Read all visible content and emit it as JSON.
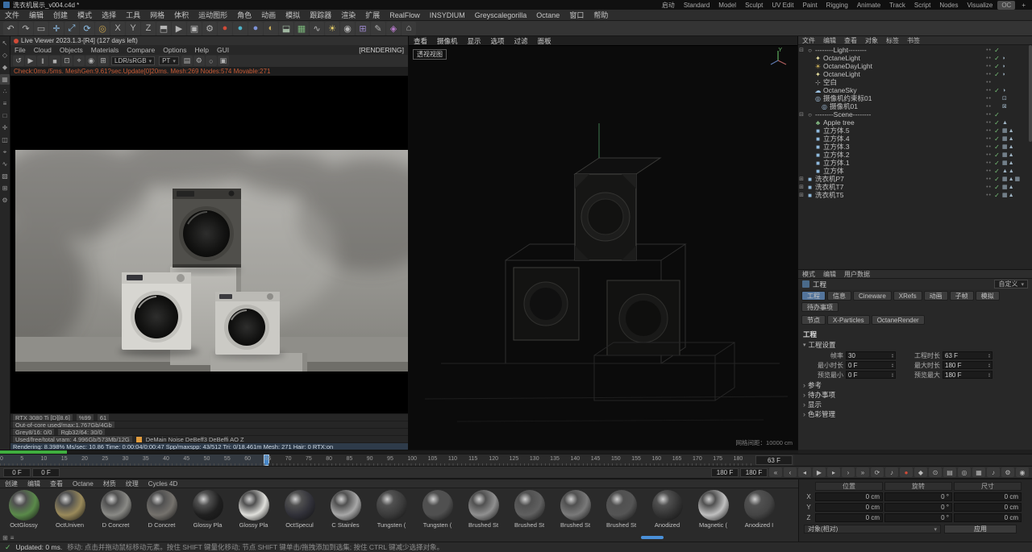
{
  "titlebar": {
    "title": "洗衣机展示_v004.c4d *",
    "layouts": [
      {
        "label": "启动"
      },
      {
        "label": "Standard"
      },
      {
        "label": "Model"
      },
      {
        "label": "Sculpt"
      },
      {
        "label": "UV Edit"
      },
      {
        "label": "Paint"
      },
      {
        "label": "Rigging"
      },
      {
        "label": "Animate"
      },
      {
        "label": "Track"
      },
      {
        "label": "Script"
      },
      {
        "label": "Nodes"
      },
      {
        "label": "Visualize"
      },
      {
        "label": "OC",
        "bg": "#4a4a4a"
      }
    ],
    "plus": "+"
  },
  "menubar": {
    "items": [
      "文件",
      "编辑",
      "创建",
      "模式",
      "选择",
      "工具",
      "网格",
      "体积",
      "运动图形",
      "角色",
      "动画",
      "模拟",
      "跟踪器",
      "渲染",
      "扩展",
      "RealFlow",
      "INSYDIUM",
      "Greyscalegorilla",
      "Octane",
      "窗口",
      "帮助"
    ]
  },
  "toolbar": {
    "items": [
      {
        "g": "↶",
        "n": "undo-icon"
      },
      {
        "g": "↷",
        "n": "redo-icon"
      },
      {
        "g": "▭",
        "n": "rectangle-select-icon"
      },
      {
        "g": "✛",
        "n": "move-tool-icon",
        "c": "#8fc1ea"
      },
      {
        "g": "⤢",
        "n": "scale-tool-icon",
        "c": "#8fc1ea"
      },
      {
        "g": "⟳",
        "n": "rotate-tool-icon",
        "c": "#8fc1ea"
      },
      {
        "g": "◎",
        "n": "last-tool-icon",
        "c": "#c8a24a"
      },
      {
        "g": "X",
        "n": "x-axis-lock-icon"
      },
      {
        "g": "Y",
        "n": "y-axis-lock-icon"
      },
      {
        "g": "Z",
        "n": "z-axis-lock-icon"
      },
      {
        "g": "⬒",
        "n": "coordinate-system-icon"
      },
      {
        "g": "▶",
        "n": "render-view-icon"
      },
      {
        "g": "▣",
        "n": "picture-viewer-icon"
      },
      {
        "g": "⚙",
        "n": "render-settings-icon"
      },
      {
        "g": "●",
        "n": "octane-live-viewer-icon",
        "c": "#d14b38"
      },
      {
        "g": "●",
        "n": "octane-material-icon",
        "c": "#4fb3c9"
      },
      {
        "g": "●",
        "n": "standard-material-icon",
        "c": "#7d92d8"
      },
      {
        "g": "◐",
        "n": "environment-icon",
        "c": "#cdb05d"
      },
      {
        "g": "⬓",
        "n": "floor-icon",
        "c": "#9fb6a0"
      },
      {
        "g": "▦",
        "n": "cube-primitive-icon",
        "c": "#79b579"
      },
      {
        "g": "∿",
        "n": "spline-icon"
      },
      {
        "g": "☀",
        "n": "light-icon",
        "c": "#e6cf6b"
      },
      {
        "g": "◉",
        "n": "camera-icon"
      },
      {
        "g": "⊞",
        "n": "mograph-icon",
        "c": "#9a86c9"
      },
      {
        "g": "✎",
        "n": "sculpt-icon"
      },
      {
        "g": "◈",
        "n": "deformer-icon",
        "c": "#b579c9"
      },
      {
        "g": "⌂",
        "n": "scene-nodes-icon"
      }
    ]
  },
  "leftstrip": {
    "items": [
      {
        "g": "↖",
        "n": "live-selection-icon"
      },
      {
        "g": "◇",
        "n": "make-editable-icon"
      },
      {
        "g": "◆",
        "n": "model-mode-icon"
      },
      {
        "g": "▦",
        "n": "texture-mode-icon",
        "bg": "#3f3f3f"
      },
      {
        "g": "∴",
        "n": "points-mode-icon"
      },
      {
        "g": "≡",
        "n": "edges-mode-icon"
      },
      {
        "g": "□",
        "n": "polygon-mode-icon"
      },
      {
        "g": "✛",
        "n": "axis-mode-icon"
      },
      {
        "g": "◫",
        "n": "workplane-icon"
      },
      {
        "g": "⌖",
        "n": "snap-icon"
      },
      {
        "g": "∿",
        "n": "spline-pen-icon"
      },
      {
        "g": "▧",
        "n": "uv-edit-icon"
      },
      {
        "g": "⊞",
        "n": "viewport-layout-icon"
      },
      {
        "g": "⚙",
        "n": "modes-settings-icon"
      }
    ]
  },
  "live_viewer": {
    "title": "Live Viewer 2023.1.3-[R4] (127 days left)",
    "menu": [
      "File",
      "Cloud",
      "Objects",
      "Materials",
      "Compare",
      "Options",
      "Help",
      "GUI"
    ],
    "rendering_badge": "[RENDERING]",
    "tools_left": [
      {
        "g": "↺",
        "n": "restart-render-icon"
      },
      {
        "g": "▶",
        "n": "resume-render-icon"
      },
      {
        "g": "‖",
        "n": "pause-render-icon"
      },
      {
        "g": "■",
        "n": "stop-render-icon"
      },
      {
        "g": "⊡",
        "n": "region-render-icon"
      },
      {
        "g": "⌖",
        "n": "focus-picker-icon"
      },
      {
        "g": "◉",
        "n": "material-picker-icon"
      },
      {
        "g": "⊞",
        "n": "lock-resolution-icon"
      }
    ],
    "lut": "LDR/sRGB",
    "kernel": "PT",
    "tools_right": [
      {
        "g": "▤",
        "n": "render-passes-icon"
      },
      {
        "g": "⚙",
        "n": "kernel-settings-icon"
      },
      {
        "g": "○",
        "n": "denoiser-icon"
      },
      {
        "g": "▣",
        "n": "camera-imager-icon"
      }
    ],
    "info_line": "Check:0ms./5ms. MeshGen:9.61?sec.Update[0]20ms. Mesh:269 Nodes:574 Movable:271",
    "stats": {
      "gpu": "RTX 3080 Ti [D][8.6]",
      "gpu_pct": "%99",
      "gpu_temp": "61",
      "outofcore": "Out-of-core used/max:1.767Gb/4Gb",
      "grey": "Grey8/16: 0/0",
      "rgb": "Rgb32/64: 30/0",
      "vram": "Used/free/total vram: 4.996Gb/573Mb/12G",
      "passes": "DeMain  Noise  DeBeff3  DeBeffi  AO  Z",
      "line5": "Rendering: 8.398%  Ms/sec: 10.86   Time: 0:00:04/0:00:47   Spp/maxspp: 43/512   Tri: 0/18.461m   Mesh: 271  Hair: 0  RTX:on"
    },
    "progress_width": "8.4%"
  },
  "viewport": {
    "menu": [
      "查看",
      "摄像机",
      "显示",
      "选项",
      "过滤",
      "面板"
    ],
    "label": "透视视图",
    "grid_info": "网格间距：10000 cm",
    "axis_y": "Y"
  },
  "object_manager": {
    "menu": [
      "文件",
      "编辑",
      "查看",
      "对象",
      "标签",
      "书签"
    ],
    "items": [
      {
        "arrow": "⊟",
        "icon": "○",
        "ic": "#b0b0b0",
        "label": "--------Light--------",
        "dots": "••",
        "check": "✓",
        "tags": "",
        "pad": "0px"
      },
      {
        "arrow": "",
        "icon": "✦",
        "ic": "#e8e0a0",
        "label": "OctaneLight",
        "dots": "••",
        "check": "✓",
        "tags": "◗",
        "pad": "10px"
      },
      {
        "arrow": "",
        "icon": "☀",
        "ic": "#e2c25f",
        "label": "OctaneDayLight",
        "dots": "••",
        "check": "✓",
        "tags": "◗",
        "pad": "10px"
      },
      {
        "arrow": "",
        "icon": "✦",
        "ic": "#e8e0a0",
        "label": "OctaneLight",
        "dots": "••",
        "check": "✓",
        "tags": "◗",
        "pad": "10px"
      },
      {
        "arrow": "",
        "icon": "⊹",
        "ic": "#b0b0b0",
        "label": "空白",
        "dots": "••",
        "check": "",
        "tags": "",
        "pad": "10px"
      },
      {
        "arrow": "",
        "icon": "☁",
        "ic": "#9ec3e4",
        "label": "OctaneSky",
        "dots": "••",
        "check": "✓",
        "tags": "◑",
        "pad": "10px"
      },
      {
        "arrow": "",
        "icon": "◎",
        "ic": "#a9c6e2",
        "label": "摄像机约束标01",
        "dots": "••",
        "check": "",
        "tags": "⊡",
        "pad": "10px"
      },
      {
        "arrow": "",
        "icon": "◎",
        "ic": "#a9c6e2",
        "label": "摄像机01",
        "dots": "••",
        "check": "",
        "tags": "⊠",
        "pad": "18px"
      },
      {
        "arrow": "⊟",
        "icon": "○",
        "ic": "#b0b0b0",
        "label": "--------Scene--------",
        "dots": "••",
        "check": "✓",
        "tags": "",
        "pad": "0px"
      },
      {
        "arrow": "",
        "icon": "♣",
        "ic": "#84bb84",
        "label": "Apple tree",
        "dots": "••",
        "check": "✓",
        "tags": "▲",
        "pad": "10px"
      },
      {
        "arrow": "",
        "icon": "■",
        "ic": "#8fb9dd",
        "label": "立方体.5",
        "dots": "••",
        "check": "✓",
        "tags": "▦▲",
        "pad": "10px"
      },
      {
        "arrow": "",
        "icon": "■",
        "ic": "#8fb9dd",
        "label": "立方体.4",
        "dots": "••",
        "check": "✓",
        "tags": "▦▲",
        "pad": "10px"
      },
      {
        "arrow": "",
        "icon": "■",
        "ic": "#8fb9dd",
        "label": "立方体.3",
        "dots": "••",
        "check": "✓",
        "tags": "▦▲",
        "pad": "10px"
      },
      {
        "arrow": "",
        "icon": "■",
        "ic": "#8fb9dd",
        "label": "立方体.2",
        "dots": "••",
        "check": "✓",
        "tags": "▦▲",
        "pad": "10px"
      },
      {
        "arrow": "",
        "icon": "■",
        "ic": "#8fb9dd",
        "label": "立方体.1",
        "dots": "••",
        "check": "✓",
        "tags": "▦▲",
        "pad": "10px"
      },
      {
        "arrow": "",
        "icon": "■",
        "ic": "#8fb9dd",
        "label": "立方体",
        "dots": "••",
        "check": "✓",
        "tags": "▲▲",
        "pad": "10px"
      },
      {
        "arrow": "⊞",
        "icon": "■",
        "ic": "#8fb9dd",
        "label": "洗衣机P7",
        "dots": "••",
        "check": "✓",
        "tags": "▦▲▦",
        "pad": "0px"
      },
      {
        "arrow": "⊞",
        "icon": "■",
        "ic": "#8fb9dd",
        "label": "洗衣机T7",
        "dots": "••",
        "check": "✓",
        "tags": "▦▲",
        "pad": "0px"
      },
      {
        "arrow": "⊞",
        "icon": "■",
        "ic": "#8fb9dd",
        "label": "洗衣机T5",
        "dots": "••",
        "check": "✓",
        "tags": "▦▲",
        "pad": "0px"
      }
    ]
  },
  "attributes": {
    "menu": [
      "模式",
      "编辑",
      "用户数据"
    ],
    "preset": "自定义",
    "object_label": "工程",
    "tabs": [
      {
        "label": "工程",
        "bg": "#53749b"
      },
      {
        "label": "信息"
      },
      {
        "label": "Cineware"
      },
      {
        "label": "XRefs"
      },
      {
        "label": "动画"
      },
      {
        "label": "子帧"
      },
      {
        "label": "模拟"
      },
      {
        "label": "待办事项"
      }
    ],
    "tabs2": [
      {
        "label": "节点"
      },
      {
        "label": "X-Particles"
      },
      {
        "label": "OctaneRender"
      }
    ],
    "group_title": "工程",
    "section": "工程设置",
    "fields": [
      {
        "l1": "帧率",
        "v1": "30",
        "l2": "工程时长",
        "v2": "63 F"
      },
      {
        "l1": "最小时长",
        "v1": "0 F",
        "l2": "最大时长",
        "v2": "180 F"
      },
      {
        "l1": "预览最小",
        "v1": "0 F",
        "l2": "预览最大",
        "v2": "180 F"
      }
    ],
    "collapsed": [
      "参考",
      "待办事项",
      "显示",
      "色彩管理"
    ]
  },
  "timeline": {
    "ticks": [
      "0",
      "5",
      "10",
      "15",
      "20",
      "25",
      "30",
      "35",
      "40",
      "45",
      "50",
      "55",
      "60",
      "65",
      "70",
      "75",
      "80",
      "85",
      "90",
      "95",
      "100",
      "105",
      "110",
      "115",
      "120",
      "125",
      "130",
      "135",
      "140",
      "145",
      "150",
      "155",
      "160",
      "165",
      "170",
      "175",
      "180"
    ],
    "current": "63 F",
    "shade_width": "35%",
    "playhead_left": "35%"
  },
  "transport": {
    "f1": "0 F",
    "f2": "0 F",
    "f3": "180 F",
    "f4": "180 F",
    "buttons": [
      {
        "g": "«",
        "n": "go-to-start-button"
      },
      {
        "g": "‹",
        "n": "previous-key-button"
      },
      {
        "g": "◂",
        "n": "previous-frame-button"
      },
      {
        "g": "▶",
        "n": "play-button"
      },
      {
        "g": "▸",
        "n": "next-frame-button"
      },
      {
        "g": "›",
        "n": "next-key-button"
      },
      {
        "g": "»",
        "n": "go-to-end-button"
      },
      {
        "g": "⟳",
        "n": "loop-mode-button"
      },
      {
        "g": "♪",
        "n": "sound-button"
      },
      {
        "g": "●",
        "n": "record-button",
        "c": "#d14b38"
      },
      {
        "g": "◆",
        "n": "keyframe-button"
      },
      {
        "g": "⊙",
        "n": "autokey-button"
      },
      {
        "g": "▤",
        "n": "key-filter-button"
      },
      {
        "g": "◎",
        "n": "key-options-button"
      }
    ],
    "right": [
      {
        "g": "▦",
        "n": "timeline-panel-icon"
      },
      {
        "g": "♪",
        "n": "sound-track-icon"
      },
      {
        "g": "⚙",
        "n": "animation-settings-icon"
      },
      {
        "g": "◉",
        "n": "render-preview-icon"
      }
    ]
  },
  "materials": {
    "menu": [
      "创建",
      "编辑",
      "查看",
      "Octane",
      "材质",
      "纹理",
      "Cycles 4D"
    ],
    "items": [
      {
        "name": "OctGlossy",
        "color": "#5a8a4a"
      },
      {
        "name": "OctUniven",
        "color": "#9a8a5a"
      },
      {
        "name": "D Concret",
        "color": "#8a8a86"
      },
      {
        "name": "D Concret",
        "color": "#75726d"
      },
      {
        "name": "Glossy Pla",
        "color": "#1f1f1f"
      },
      {
        "name": "Glossy Pla",
        "color": "#e0e0dc"
      },
      {
        "name": "OctSpecul",
        "color": "#303038"
      },
      {
        "name": "C Stainles",
        "color": "#a8a8a8"
      },
      {
        "name": "Tungsten (",
        "color": "#3a3a3a"
      },
      {
        "name": "Tungsten (",
        "color": "#505050"
      },
      {
        "name": "Brushed St",
        "color": "#909090"
      },
      {
        "name": "Brushed St",
        "color": "#606060"
      },
      {
        "name": "Brushed St",
        "color": "#7a7a7a"
      },
      {
        "name": "Brushed St",
        "color": "#555555"
      },
      {
        "name": "Anodized",
        "color": "#333333"
      },
      {
        "name": "Magnetic (",
        "color": "#c0c0c0"
      },
      {
        "name": "Anodized I",
        "color": "#444444"
      }
    ]
  },
  "coordinates": {
    "headers": [
      "位置",
      "旋转",
      "尺寸"
    ],
    "rows": [
      {
        "axis": "X",
        "p": "0 cm",
        "r": "0 °",
        "s": "0 cm"
      },
      {
        "axis": "Y",
        "p": "0 cm",
        "r": "0 °",
        "s": "0 cm"
      },
      {
        "axis": "Z",
        "p": "0 cm",
        "r": "0 °",
        "s": "0 cm"
      }
    ],
    "mode": "对象(相对)",
    "apply": "应用"
  },
  "bottombar": {
    "icons": [
      {
        "g": "⊞",
        "n": "material-grid-view-icon"
      },
      {
        "g": "≡",
        "n": "material-list-view-icon"
      }
    ]
  },
  "statusbar": {
    "check": "✓",
    "updated": "Updated: 0 ms.",
    "hint": "移动: 点击并拖动鼠标移动元素。按住 SHIFT 键量化移动; 节点 SHIFT 键单击/拖拽添加到选集; 按住 CTRL 键减少选择对象。"
  }
}
